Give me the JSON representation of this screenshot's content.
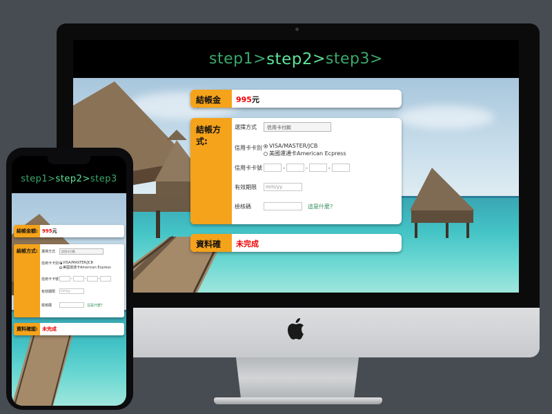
{
  "steps": {
    "step1": "step1",
    "sep1": ">",
    "step2": "step2",
    "sep2": ">",
    "step3": "step3",
    "sep3": ">"
  },
  "checkout": {
    "amount_label": "結帳金額:",
    "amount_value": "995",
    "amount_unit": "元",
    "payment_label": "結帳方式:",
    "method_label": "選擇方式",
    "method_value": "信用卡付款",
    "card_type_label": "信用卡卡別",
    "card_type_options": [
      "VISA/MASTER/JCB",
      "美國運通卡American Ecpress"
    ],
    "card_type_selected": 0,
    "card_number_label": "信用卡卡號",
    "card_number_dash": "-",
    "expiry_label": "有效期限",
    "expiry_placeholder": "mm/yy",
    "cvv_label": "檢核碼",
    "cvv_help_link": "這是什麼?",
    "confirm_label": "資料確認:",
    "confirm_status": "未完成"
  },
  "colors": {
    "accent": "#f5a31a",
    "status_red": "#e00000",
    "step_active": "#5fe39a",
    "step_dim": "#3aa86a",
    "link": "#2e8b57"
  },
  "icons": {
    "apple": "apple-logo-icon"
  }
}
